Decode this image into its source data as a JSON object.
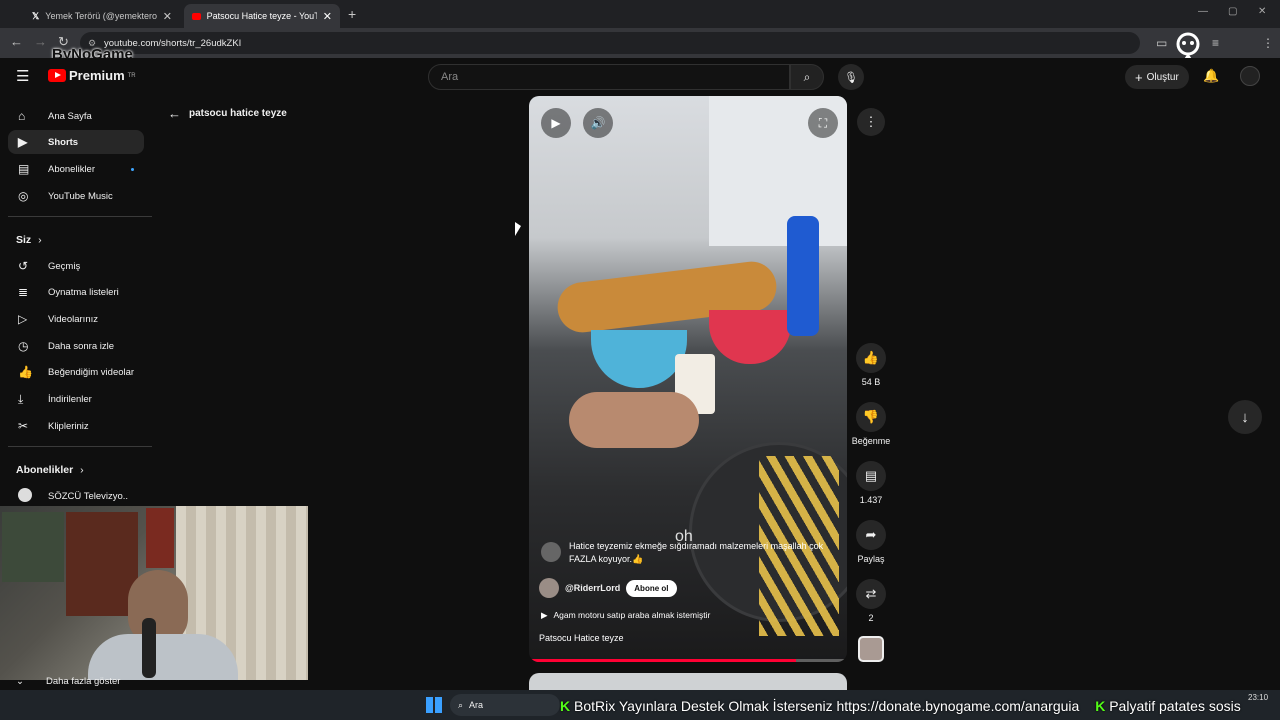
{
  "browser": {
    "tabs": [
      {
        "label": "Yemek Terörü (@yemekteroru_)",
        "icon": "x-logo-icon"
      },
      {
        "label": "Patsocu Hatice teyze - YouTube",
        "icon": "youtube-icon"
      }
    ],
    "url": "youtube.com/shorts/tr_26udkZKI"
  },
  "youtube": {
    "logo_text": "Premium",
    "logo_region": "TR",
    "search_placeholder": "Ara",
    "create_label": "Oluştur",
    "accent_color": "#ff0000"
  },
  "sidebar": {
    "main_items": [
      {
        "label": "Ana Sayfa",
        "icon": "home-icon"
      },
      {
        "label": "Shorts",
        "icon": "shorts-icon",
        "active": true
      },
      {
        "label": "Abonelikler",
        "icon": "subscriptions-icon",
        "badge": true
      },
      {
        "label": "YouTube Music",
        "icon": "music-icon"
      }
    ],
    "you_heading": "Siz",
    "you_items": [
      {
        "label": "Geçmiş",
        "icon": "history-icon"
      },
      {
        "label": "Oynatma listeleri",
        "icon": "playlist-icon"
      },
      {
        "label": "Videolarınız",
        "icon": "video-icon"
      },
      {
        "label": "Daha sonra izle",
        "icon": "clock-icon"
      },
      {
        "label": "Beğendiğim videolar",
        "icon": "thumbs-up-icon"
      },
      {
        "label": "İndirilenler",
        "icon": "download-icon"
      },
      {
        "label": "Klipleriniz",
        "icon": "scissors-icon"
      }
    ],
    "subs_heading": "Abonelikler",
    "subs_items": [
      {
        "label": "SÖZCÜ Televizyo..."
      }
    ],
    "show_more": "Daha fazla göster"
  },
  "page": {
    "back_title": "patsocu hatice teyze"
  },
  "short": {
    "caption": "Hatice teyzemiz ekmeğe sığdıramadı malzemeleri maşallah çok FAZLA koyuyor.👍",
    "subtitle_word": "oh",
    "channel": "@RiderrLord",
    "subscribe_label": "Abone ol",
    "music": "Agam motoru satıp araba almak istemiştir",
    "title": "Patsocu Hatice teyze",
    "progress": 0.84
  },
  "actions": {
    "likes": "54 B",
    "dislike_label": "Beğenme",
    "comments": "1.437",
    "share_label": "Paylaş",
    "remix_count": "2"
  },
  "stream": {
    "overlay_logo": "ByNoGame",
    "ticker": "BotRix Yayınlara Destek Olmak İsterseniz https://donate.bynogame.com/anarguia",
    "ticker2": "Palyatif patates sosis",
    "taskbar_search": "Ara",
    "time": "23:10"
  }
}
